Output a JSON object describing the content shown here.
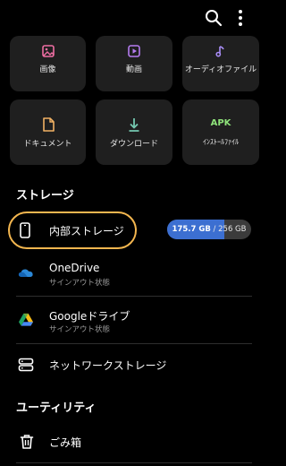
{
  "categories": [
    {
      "label": "画像",
      "icon": "image-icon"
    },
    {
      "label": "動画",
      "icon": "video-icon"
    },
    {
      "label": "オーディオファイル",
      "icon": "music-note-icon"
    },
    {
      "label": "ドキュメント",
      "icon": "document-icon"
    },
    {
      "label": "ダウンロード",
      "icon": "download-icon"
    },
    {
      "label": "ｲﾝｽﾄｰﾙﾌｧｲﾙ",
      "icon_text": "APK"
    }
  ],
  "storage": {
    "section_title": "ストレージ",
    "internal": {
      "label": "内部ストレージ",
      "used": "175.7 GB",
      "separator": " / ",
      "total": "256 GB",
      "used_fraction": 0.686
    },
    "onedrive": {
      "label": "OneDrive",
      "status": "サインアウト状態"
    },
    "google_drive": {
      "label": "Googleドライブ",
      "status": "サインアウト状態"
    },
    "network": {
      "label": "ネットワークストレージ"
    }
  },
  "utilities": {
    "section_title": "ユーティリティ",
    "trash": {
      "label": "ごみ箱"
    }
  },
  "colors": {
    "accent_blue": "#3c6fd1",
    "highlight": "#f3b64f",
    "image_icon": "#ef6ea3",
    "video_icon": "#b57cf0",
    "audio_icon": "#a88cf6",
    "document_icon": "#f1b164",
    "download_icon": "#74c8b0",
    "apk": "#8ee37a"
  }
}
